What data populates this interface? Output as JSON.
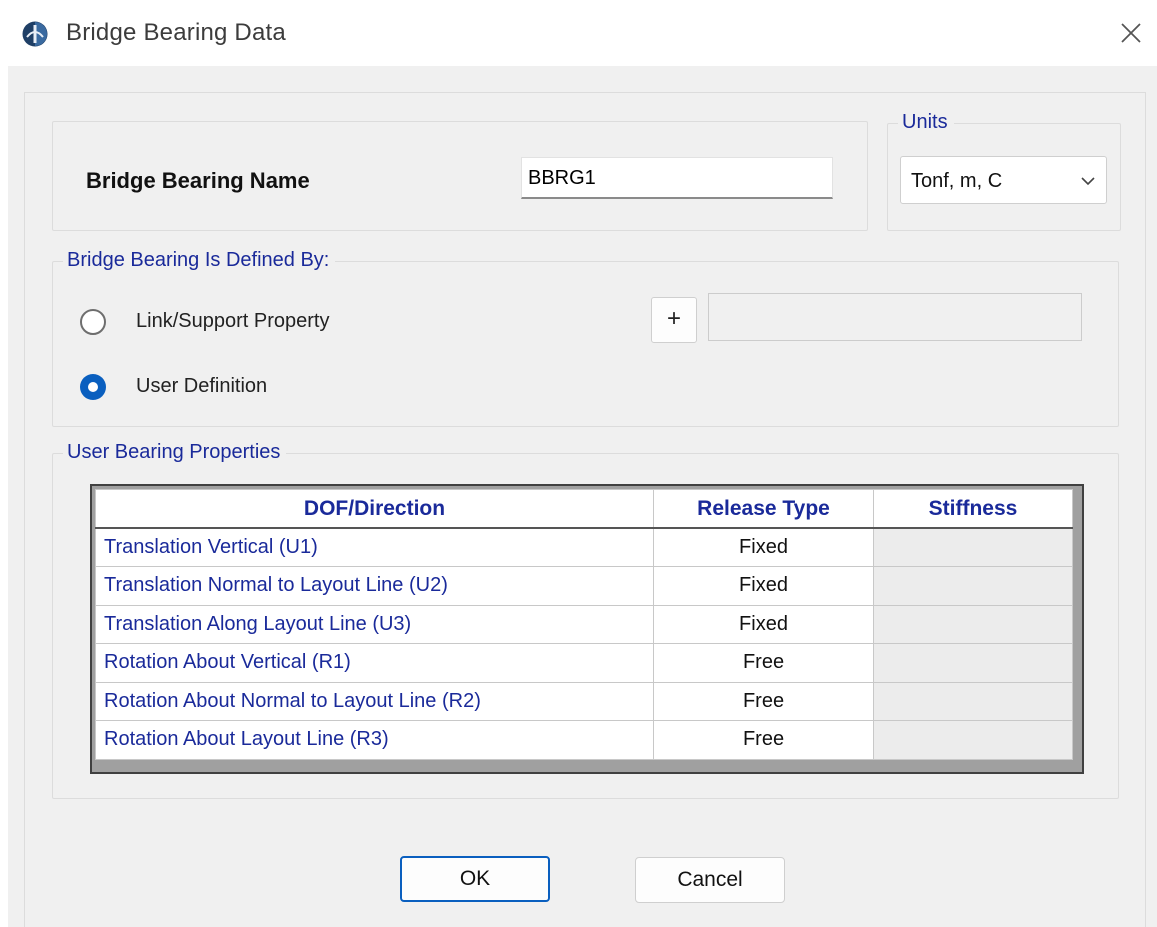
{
  "window": {
    "title": "Bridge Bearing Data",
    "app_icon": "csi-logo-icon",
    "close_icon": "close-icon"
  },
  "name_group": {
    "label": "Bridge Bearing Name",
    "value": "BBRG1"
  },
  "units": {
    "title": "Units",
    "selected": "Tonf, m, C"
  },
  "definition": {
    "title": "Bridge Bearing Is Defined By:",
    "options": [
      {
        "label": "Link/Support Property",
        "selected": false
      },
      {
        "label": "User Definition",
        "selected": true
      }
    ],
    "add_label": "+",
    "property_value": ""
  },
  "properties": {
    "title": "User Bearing Properties",
    "columns": [
      "DOF/Direction",
      "Release Type",
      "Stiffness"
    ],
    "rows": [
      {
        "dof": "Translation Vertical (U1)",
        "release": "Fixed",
        "stiffness": ""
      },
      {
        "dof": "Translation Normal to Layout Line (U2)",
        "release": "Fixed",
        "stiffness": ""
      },
      {
        "dof": "Translation Along Layout Line (U3)",
        "release": "Fixed",
        "stiffness": ""
      },
      {
        "dof": "Rotation About Vertical (R1)",
        "release": "Free",
        "stiffness": ""
      },
      {
        "dof": "Rotation About Normal to Layout Line (R2)",
        "release": "Free",
        "stiffness": ""
      },
      {
        "dof": "Rotation About Layout Line (R3)",
        "release": "Free",
        "stiffness": ""
      }
    ]
  },
  "buttons": {
    "ok": "OK",
    "cancel": "Cancel"
  },
  "colors": {
    "accent": "#0a5fbf",
    "group_title": "#1a2a9a",
    "dialog_bg": "#f0f0f0"
  }
}
